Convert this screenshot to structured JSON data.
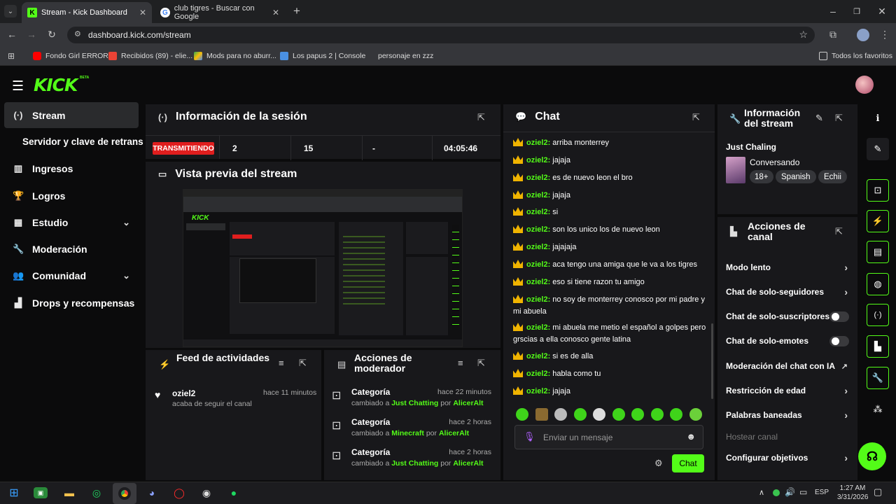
{
  "browser": {
    "tabs": [
      {
        "title": "Stream - Kick Dashboard",
        "active": true,
        "icon": "kick-icon"
      },
      {
        "title": "club tigres - Buscar con Google",
        "active": false,
        "icon": "google-icon"
      }
    ],
    "url": "dashboard.kick.com/stream",
    "bookmarks": [
      "Fondo Girl ERROR",
      "Recibidos (89) - elie...",
      "Mods para no aburr...",
      "Los papus 2 | Console",
      "personaje en zzz"
    ],
    "all_bookmarks": "Todos los favoritos"
  },
  "app": {
    "logo": "KICK",
    "beta": "BETA",
    "accent": "#53fc18"
  },
  "sidebar": {
    "items": [
      {
        "label": "Stream",
        "icon": "broadcast-icon",
        "active": true
      },
      {
        "label": "Servidor y clave de retransmisión",
        "icon": "",
        "active": false
      },
      {
        "label": "Ingresos",
        "icon": "chart-icon",
        "active": false
      },
      {
        "label": "Logros",
        "icon": "trophy-icon",
        "active": false
      },
      {
        "label": "Estudio",
        "icon": "studio-icon",
        "active": false,
        "expandable": true
      },
      {
        "label": "Moderación",
        "icon": "wrench-icon",
        "active": false
      },
      {
        "label": "Comunidad",
        "icon": "people-icon",
        "active": false,
        "expandable": true
      },
      {
        "label": "Drops y recompensas",
        "icon": "drops-icon",
        "active": false
      }
    ]
  },
  "session": {
    "title": "Información de la sesión",
    "status": "TRANSMITIENDO",
    "stats": [
      "2",
      "15",
      "-",
      "04:05:46"
    ]
  },
  "preview": {
    "title": "Vista previa del stream"
  },
  "feed": {
    "title": "Feed de actividades",
    "items": [
      {
        "user": "oziel2",
        "time": "hace 11 minutos",
        "text": "acaba de seguir el canal"
      }
    ]
  },
  "mod_actions": {
    "title": "Acciones de moderador",
    "items": [
      {
        "title": "Categoría",
        "time": "hace 22 minutos",
        "prefix": "cambiado a",
        "category": "Just Chatting",
        "by": "por",
        "user": "AlicerAlt"
      },
      {
        "title": "Categoría",
        "time": "hace 2 horas",
        "prefix": "cambiado a",
        "category": "Minecraft",
        "by": "por",
        "user": "AlicerAlt"
      },
      {
        "title": "Categoría",
        "time": "hace 2 horas",
        "prefix": "cambiado a",
        "category": "Just Chatting",
        "by": "por",
        "user": "AlicerAlt"
      }
    ]
  },
  "chat": {
    "title": "Chat",
    "messages": [
      {
        "user": "oziel2:",
        "text": "arriba monterrey"
      },
      {
        "user": "oziel2:",
        "text": "jajaja"
      },
      {
        "user": "oziel2:",
        "text": "es de nuevo leon el bro"
      },
      {
        "user": "oziel2:",
        "text": "jajaja"
      },
      {
        "user": "oziel2:",
        "text": "si"
      },
      {
        "user": "oziel2:",
        "text": "son los unico los de nuevo leon"
      },
      {
        "user": "oziel2:",
        "text": "jajajaja"
      },
      {
        "user": "oziel2:",
        "text": "aca tengo una amiga que le va a los tigres"
      },
      {
        "user": "oziel2:",
        "text": "eso si tiene razon tu amigo"
      },
      {
        "user": "oziel2:",
        "text": "no soy de monterrey conosco por mi padre y mi abuela"
      },
      {
        "user": "oziel2:",
        "text": "mi abuela me metio el español a golpes pero grscias a ella conosco gente latina"
      },
      {
        "user": "oziel2:",
        "text": "si es de alla"
      },
      {
        "user": "oziel2:",
        "text": "habla como tu"
      },
      {
        "user": "oziel2:",
        "text": "jajaja"
      }
    ],
    "placeholder": "Enviar un mensaje",
    "send_label": "Chat"
  },
  "stream_info": {
    "title_line1": "Información",
    "title_line2": "del stream",
    "stream_title": "Just Chaling",
    "category": "Conversando",
    "tags": [
      "18+",
      "Spanish",
      "Echii"
    ]
  },
  "channel_actions": {
    "title_line1": "Acciones de",
    "title_line2": "canal",
    "items": [
      {
        "label": "Modo lento",
        "control": "chevron"
      },
      {
        "label": "Chat de solo-seguidores",
        "control": "chevron"
      },
      {
        "label": "Chat de solo-suscriptores",
        "control": "toggle"
      },
      {
        "label": "Chat de solo-emotes",
        "control": "toggle"
      },
      {
        "label": "Moderación del chat con IA",
        "control": "external"
      },
      {
        "label": "Restricción de edad",
        "control": "chevron"
      },
      {
        "label": "Palabras baneadas",
        "control": "chevron"
      },
      {
        "label": "Hostear canal",
        "control": "disabled"
      },
      {
        "label": "Configurar objetivos",
        "control": "chevron"
      }
    ]
  },
  "taskbar": {
    "lang": "ESP",
    "time": "1:27 AM",
    "date": "3/31/2026"
  }
}
